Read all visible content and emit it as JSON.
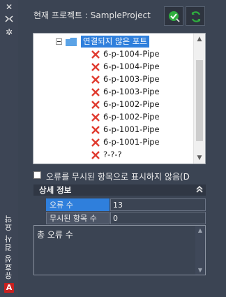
{
  "palette": {
    "panel_bg": "#3b4453",
    "strip_bg": "#3d4555",
    "selection": "#2f7fdc",
    "error_x": "#e03b30",
    "check_green": "#2fae3f",
    "folder": "#5ba3e6"
  },
  "side_strip": {
    "title": "유효성 검사 요약",
    "icons": [
      "close-icon",
      "pin-icon",
      "settings-icon",
      "autocad-app-icon"
    ]
  },
  "header": {
    "project_label": "현재 프로젝트 : SampleProject",
    "buttons": [
      "validate-icon",
      "refresh-icon"
    ]
  },
  "tree": {
    "folder_label": "연결되지 않은 포트",
    "items": [
      "6-p-1004-Pipe",
      "6-p-1004-Pipe",
      "6-p-1003-Pipe",
      "6-p-1003-Pipe",
      "6-p-1002-Pipe",
      "6-p-1002-Pipe",
      "6-p-1001-Pipe",
      "6-p-1001-Pipe",
      "?-?-?",
      "?-?-?"
    ]
  },
  "ignore_checkbox": {
    "label": "오류를 무시된 항목으로 표시하지 않음(D",
    "checked": false
  },
  "details": {
    "title": "상세 정보",
    "rows": [
      {
        "key": "오류 수",
        "value": "13"
      },
      {
        "key": "무시된 항목 수",
        "value": "0"
      }
    ],
    "description": "총 오류 수"
  }
}
